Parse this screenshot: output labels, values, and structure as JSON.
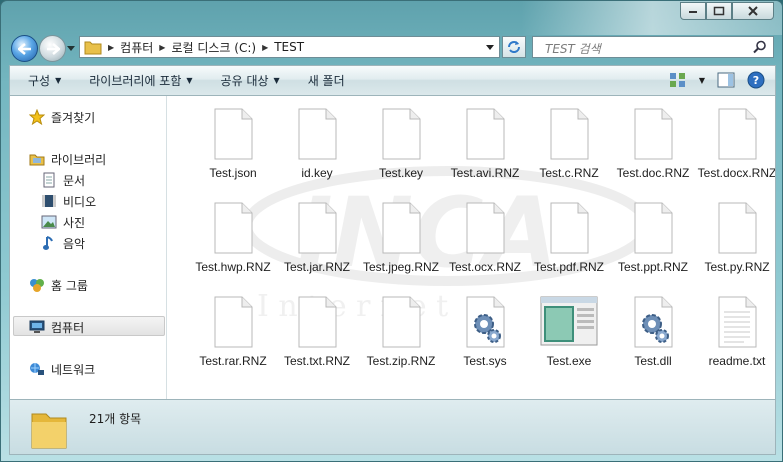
{
  "window": {
    "caption_buttons": [
      "minimize",
      "maximize",
      "close"
    ]
  },
  "address": {
    "breadcrumb": [
      "컴퓨터",
      "로컬 디스크 (C:)",
      "TEST"
    ],
    "search_placeholder": "TEST 검색"
  },
  "commandbar": {
    "organize": "구성",
    "include_library": "라이브러리에 포함",
    "share_with": "공유 대상",
    "new_folder": "새 폴더"
  },
  "navpane": {
    "favorites": "즐겨찾기",
    "libraries": "라이브러리",
    "documents": "문서",
    "videos": "비디오",
    "pictures": "사진",
    "music": "음악",
    "homegroup": "홈 그룹",
    "computer": "컴퓨터",
    "network": "네트워크"
  },
  "files": [
    {
      "name": "Test.json",
      "type": "doc"
    },
    {
      "name": "id.key",
      "type": "doc"
    },
    {
      "name": "Test.key",
      "type": "doc"
    },
    {
      "name": "Test.avi.RNZ",
      "type": "doc"
    },
    {
      "name": "Test.c.RNZ",
      "type": "doc"
    },
    {
      "name": "Test.doc.RNZ",
      "type": "doc"
    },
    {
      "name": "Test.docx.RNZ",
      "type": "doc"
    },
    {
      "name": "Test.hwp.RNZ",
      "type": "doc"
    },
    {
      "name": "Test.jar.RNZ",
      "type": "doc"
    },
    {
      "name": "Test.jpeg.RNZ",
      "type": "doc"
    },
    {
      "name": "Test.ocx.RNZ",
      "type": "doc"
    },
    {
      "name": "Test.pdf.RNZ",
      "type": "doc"
    },
    {
      "name": "Test.ppt.RNZ",
      "type": "doc"
    },
    {
      "name": "Test.py.RNZ",
      "type": "doc"
    },
    {
      "name": "Test.rar.RNZ",
      "type": "doc"
    },
    {
      "name": "Test.txt.RNZ",
      "type": "doc"
    },
    {
      "name": "Test.zip.RNZ",
      "type": "doc"
    },
    {
      "name": "Test.sys",
      "type": "sys"
    },
    {
      "name": "Test.exe",
      "type": "exe"
    },
    {
      "name": "Test.dll",
      "type": "sys"
    },
    {
      "name": "readme.txt",
      "type": "txt"
    }
  ],
  "watermark": {
    "logo": "INCA",
    "subtitle": "I n t e r n e t"
  },
  "status": {
    "item_count": "21개 항목"
  }
}
